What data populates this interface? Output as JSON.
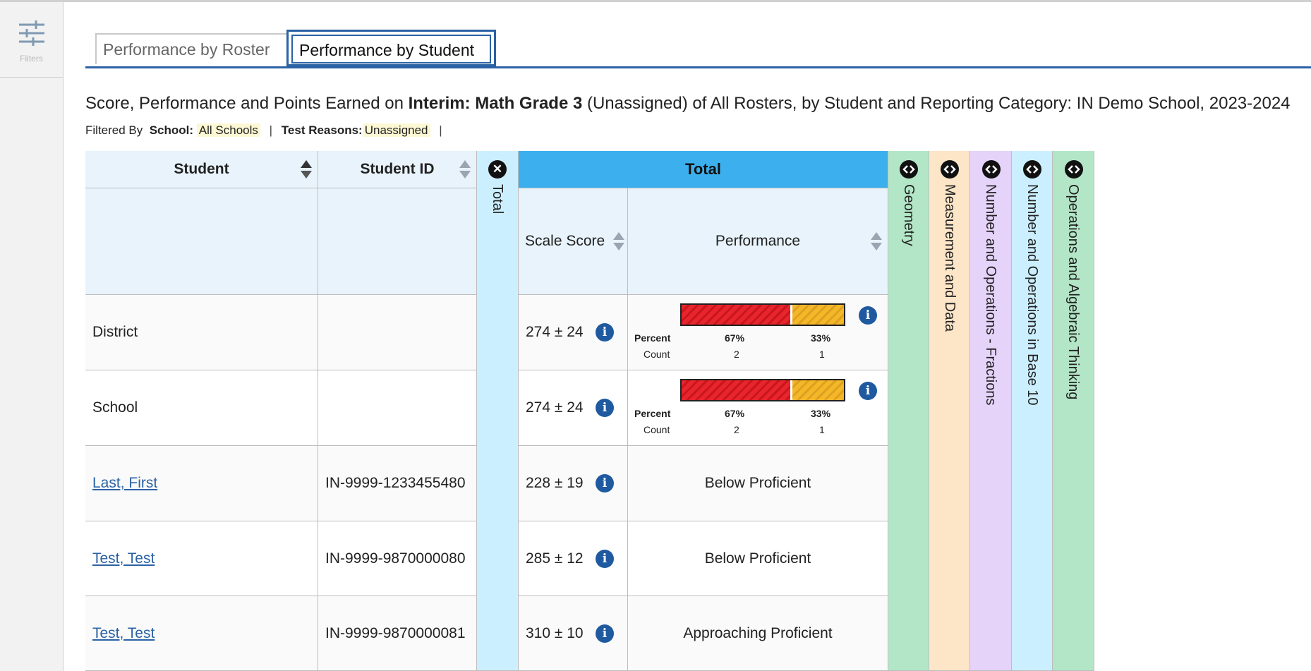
{
  "sidebar": {
    "filters_label": "Filters"
  },
  "tabs": [
    {
      "label": "Performance by Roster",
      "selected": false
    },
    {
      "label": "Performance by Student",
      "selected": true
    }
  ],
  "caption": {
    "prefix": "Score, Performance and Points Earned on ",
    "assessment": "Interim: Math Grade 3",
    "suffix": " (Unassigned) of All Rosters, by Student and Reporting Category: IN Demo School, 2023-2024"
  },
  "filtered_by": {
    "label": "Filtered By",
    "school_label": "School:",
    "school_value": "All Schools",
    "reasons_label": "Test Reasons:",
    "reasons_value": "Unassigned",
    "separator": "|"
  },
  "table": {
    "headers": {
      "student": "Student",
      "student_id": "Student ID",
      "total_collapsed": "Total",
      "total_group": "Total",
      "scale_score": "Scale Score",
      "performance": "Performance"
    },
    "categories": [
      {
        "label": "Geometry",
        "color": "#b3e6c7"
      },
      {
        "label": "Measurement and Data",
        "color": "#fde5c8"
      },
      {
        "label": "Number and Operations - Fractions",
        "color": "#e5d3f9"
      },
      {
        "label": "Number and Operations in Base 10",
        "color": "#ccefff"
      },
      {
        "label": "Operations and Algebraic Thinking",
        "color": "#b3e6c7"
      }
    ],
    "bar_labels": {
      "percent": "Percent",
      "count": "Count"
    },
    "rows": [
      {
        "student": "District",
        "student_id": "",
        "scale_score": "274 ± 24",
        "dist": {
          "red_pct": "67%",
          "red_count": "2",
          "yel_pct": "33%",
          "yel_count": "1",
          "red_share": 0.67
        }
      },
      {
        "student": "School",
        "student_id": "",
        "scale_score": "274 ± 24",
        "dist": {
          "red_pct": "67%",
          "red_count": "2",
          "yel_pct": "33%",
          "yel_count": "1",
          "red_share": 0.67
        }
      },
      {
        "student": "Last, First",
        "student_id": "IN-9999-1233455480",
        "scale_score": "228 ± 19",
        "performance": "Below Proficient"
      },
      {
        "student": "Test, Test",
        "student_id": "IN-9999-9870000080",
        "scale_score": "285 ± 12",
        "performance": "Below Proficient"
      },
      {
        "student": "Test, Test",
        "student_id": "IN-9999-9870000081",
        "scale_score": "310 ± 10",
        "performance": "Approaching Proficient"
      }
    ]
  },
  "icons": {
    "info": "info-icon",
    "close": "close-circle-icon",
    "expand": "expand-icon",
    "filters": "sliders-icon"
  }
}
